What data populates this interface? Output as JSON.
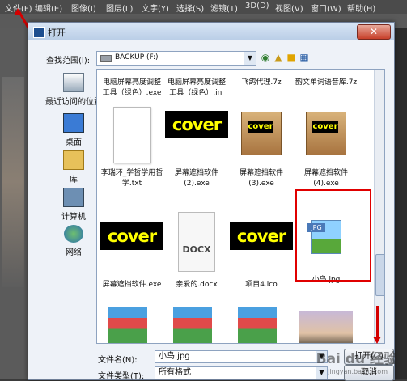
{
  "ps_menu": {
    "file": "文件(F)",
    "edit": "编辑(E)",
    "image": "图像(I)",
    "layer": "图层(L)",
    "text": "文字(Y)",
    "select": "选择(S)",
    "filter": "滤镜(T)",
    "3d": "3D(D)",
    "view": "视图(V)",
    "window": "窗口(W)",
    "help": "帮助(H)"
  },
  "dialog": {
    "title": "打开",
    "close_glyph": "✕",
    "lookin_label": "查找范围(I):",
    "lookin_value": "BACKUP  (F:)",
    "places": [
      "最近访问的位置",
      "桌面",
      "库",
      "计算机",
      "网络"
    ],
    "files": [
      {
        "name": "电脑屏幕亮度调整工具（绿色）.exe"
      },
      {
        "name": "电脑屏幕亮度调整工具（绿色）.ini"
      },
      {
        "name": "飞鸽代理.7z"
      },
      {
        "name": "韵文单词语音库.7z"
      },
      {
        "name": "李瑞环_学哲学用哲学.txt"
      },
      {
        "name": "屏幕遮挡软件(2).exe",
        "thumb_text": "cover"
      },
      {
        "name": "屏幕遮挡软件(3).exe",
        "thumb_text": "cover"
      },
      {
        "name": "屏幕遮挡软件(4).exe",
        "thumb_text": "cover"
      },
      {
        "name": "屏幕遮挡软件.exe",
        "thumb_text": "cover"
      },
      {
        "name": "亲爱的.docx",
        "thumb_text": "DOCX"
      },
      {
        "name": "项目4.ico",
        "thumb_text": "cover"
      },
      {
        "name": "小鸟.jpg",
        "thumb_text": "JPG"
      }
    ],
    "filename_label": "文件名(N):",
    "filename_value": "小鸟.jpg",
    "filetype_label": "文件类型(T):",
    "filetype_value": "所有格式",
    "open_button": "打开(O)",
    "cancel_button": "取消"
  },
  "watermark": {
    "brand": "Bai du 经验",
    "url": "jingyan.baidu.com"
  },
  "colors": {
    "highlight": "#e00000",
    "cover_text": "#ffff00"
  }
}
